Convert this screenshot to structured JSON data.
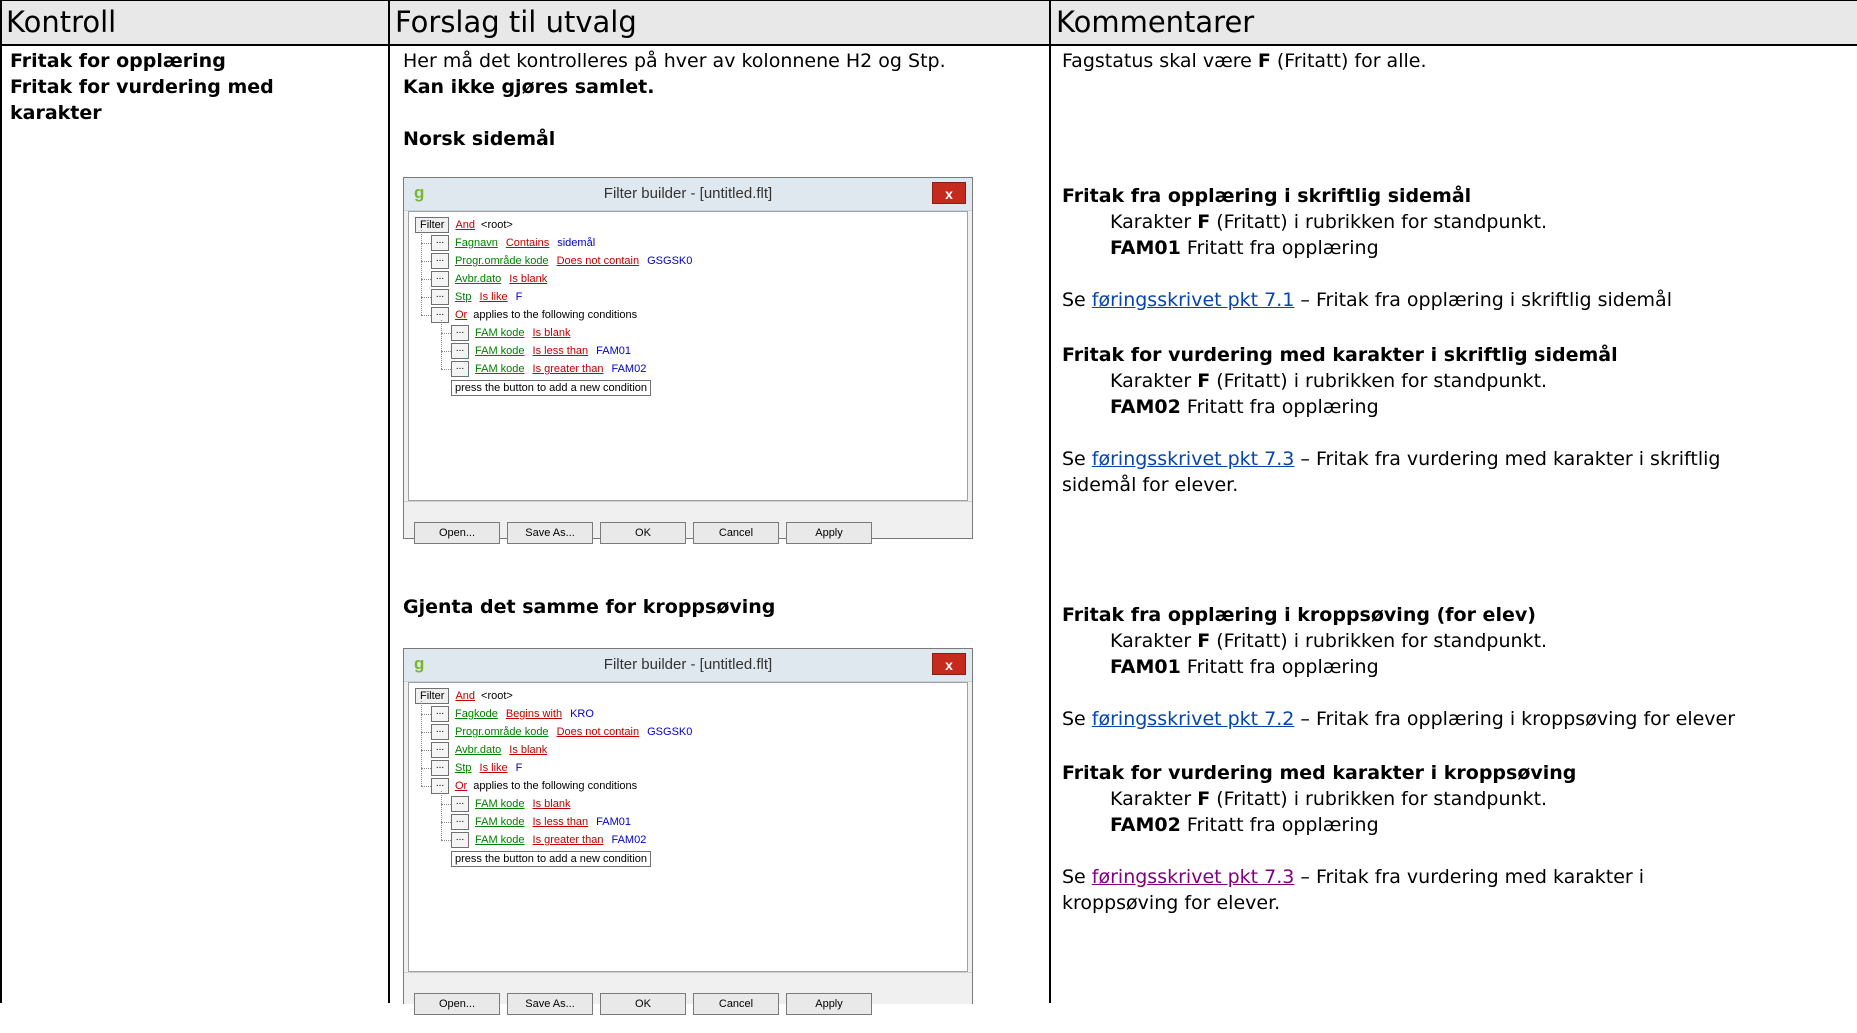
{
  "headers": {
    "kontroll": "Kontroll",
    "forslag": "Forslag til utvalg",
    "kommentarer": "Kommentarer"
  },
  "kontroll": {
    "line1": "Fritak for opplæring",
    "line2": "Fritak for vurdering med",
    "line3": "karakter"
  },
  "forslag": {
    "intro": "Her må det kontrolleres på hver av kolonnene H2 og Stp.",
    "intro_bold": "Kan ikke gjøres samlet.",
    "heading1": "Norsk sidemål",
    "heading2": "Gjenta det samme for kroppsøving"
  },
  "filter_builder_1": {
    "title": "Filter builder - [untitled.flt]",
    "close": "x",
    "filter_btn": "Filter",
    "root_op": "And",
    "root_label": "<root>",
    "conditions": [
      {
        "field": "Fagnavn",
        "operator": "Contains",
        "value": "sidemål"
      },
      {
        "field": "Progr.område kode",
        "operator": "Does not contain",
        "value": "GSGSK0"
      },
      {
        "field": "Avbr.dato",
        "operator": "Is blank",
        "value": ""
      },
      {
        "field": "Stp",
        "operator": "Is like",
        "value": "F"
      }
    ],
    "group": {
      "op": "Or",
      "text": "applies to the following conditions"
    },
    "sub_conditions": [
      {
        "field": "FAM kode",
        "operator": "Is blank",
        "value": ""
      },
      {
        "field": "FAM kode",
        "operator": "Is less than",
        "value": "FAM01"
      },
      {
        "field": "FAM kode",
        "operator": "Is greater than",
        "value": "FAM02"
      }
    ],
    "add_hint": "press the button to add a new condition",
    "buttons": [
      "Open...",
      "Save As...",
      "OK",
      "Cancel",
      "Apply"
    ]
  },
  "filter_builder_2": {
    "title": "Filter builder - [untitled.flt]",
    "close": "x",
    "filter_btn": "Filter",
    "root_op": "And",
    "root_label": "<root>",
    "conditions": [
      {
        "field": "Fagkode",
        "operator": "Begins with",
        "value": "KRO"
      },
      {
        "field": "Progr.område kode",
        "operator": "Does not contain",
        "value": "GSGSK0"
      },
      {
        "field": "Avbr.dato",
        "operator": "Is blank",
        "value": ""
      },
      {
        "field": "Stp",
        "operator": "Is like",
        "value": "F"
      }
    ],
    "group": {
      "op": "Or",
      "text": "applies to the following conditions"
    },
    "sub_conditions": [
      {
        "field": "FAM kode",
        "operator": "Is blank",
        "value": ""
      },
      {
        "field": "FAM kode",
        "operator": "Is less than",
        "value": "FAM01"
      },
      {
        "field": "FAM kode",
        "operator": "Is greater than",
        "value": "FAM02"
      }
    ],
    "add_hint": "press the button to add a new condition",
    "buttons": [
      "Open...",
      "Save As...",
      "OK",
      "Cancel",
      "Apply"
    ]
  },
  "kommentarer": {
    "fagstatus_pre": "Fagstatus skal være ",
    "fagstatus_bold": "F",
    "fagstatus_post": " (Fritatt) for alle.",
    "sections": [
      {
        "heading": "Fritak fra opplæring i skriftlig sidemål",
        "line1_pre": "Karakter ",
        "line1_bold": "F",
        "line1_post": " (Fritatt) i rubrikken for standpunkt.",
        "line2_bold": "FAM01",
        "line2_post": " Fritatt fra opplæring",
        "se": "Se ",
        "link": "føringsskrivet pkt 7.1",
        "ref": " – Fritak fra opplæring i skriftlig sidemål",
        "ref2": ""
      },
      {
        "heading": "Fritak for vurdering med karakter i skriftlig sidemål",
        "line1_pre": "Karakter ",
        "line1_bold": "F",
        "line1_post": " (Fritatt) i rubrikken for standpunkt.",
        "line2_bold": "FAM02",
        "line2_post": " Fritatt fra opplæring",
        "se": "Se ",
        "link": "føringsskrivet pkt 7.3",
        "ref": " – Fritak fra vurdering med karakter i skriftlig",
        "ref2": "sidemål for elever."
      },
      {
        "heading": "Fritak fra opplæring i kroppsøving (for elev)",
        "line1_pre": "Karakter ",
        "line1_bold": "F",
        "line1_post": " (Fritatt) i rubrikken for standpunkt.",
        "line2_bold": "FAM01",
        "line2_post": " Fritatt fra opplæring",
        "se": "Se ",
        "link": "føringsskrivet pkt 7.2",
        "ref": " – Fritak fra opplæring i kroppsøving for elever",
        "ref2": ""
      },
      {
        "heading": "Fritak for vurdering med karakter i kroppsøving",
        "line1_pre": "Karakter ",
        "line1_bold": "F",
        "line1_post": " (Fritatt) i rubrikken for standpunkt.",
        "line2_bold": "FAM02",
        "line2_post": " Fritatt fra opplæring",
        "se": "Se ",
        "link": "føringsskrivet pkt 7.3",
        "ref": " – Fritak fra vurdering med karakter i",
        "ref2": "kroppsøving for elever."
      }
    ]
  }
}
